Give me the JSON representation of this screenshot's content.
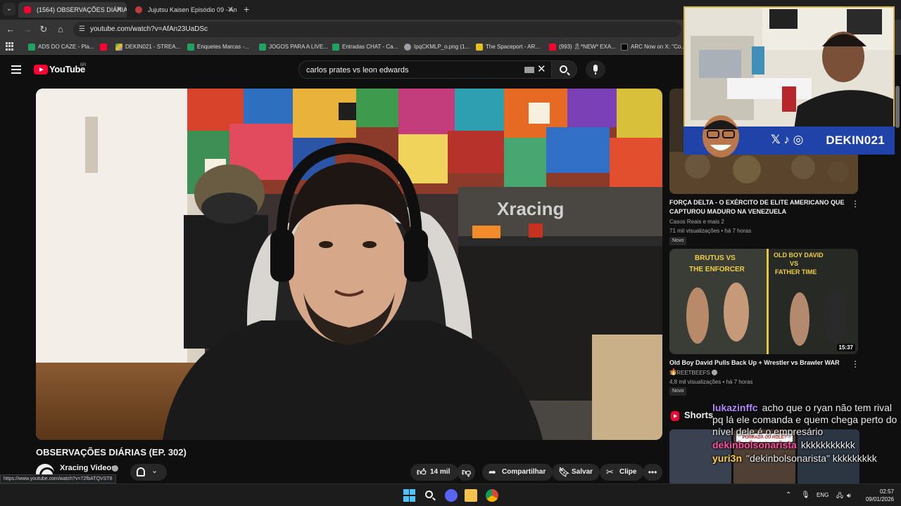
{
  "browser": {
    "tabs": [
      {
        "label": "(1564) OBSERVAÇÕES DIÁRIAS",
        "active": true
      },
      {
        "label": "Jujutsu Kaisen Episódio 09 - An",
        "active": false
      }
    ],
    "url": "youtube.com/watch?v=AfAn23UaDSc",
    "bookmarks": [
      {
        "label": "ADS DO CAZE - Pla...",
        "icon": "sheets-icon"
      },
      {
        "label": "",
        "icon": "youtube-icon"
      },
      {
        "label": "DEKIN021 - STREA...",
        "icon": "drive-icon"
      },
      {
        "label": "Enquetes Marcas -...",
        "icon": "sheets-icon"
      },
      {
        "label": "JOGOS PARA A LIVE...",
        "icon": "sheets-icon"
      },
      {
        "label": "Entradas CHAT - Ca...",
        "icon": "sheets-icon"
      },
      {
        "label": "IpqCKMLP_o.png (1...",
        "icon": "globe-icon"
      },
      {
        "label": "The Spaceport - AR...",
        "icon": "spaceport-icon"
      },
      {
        "label": "(993) 🎗*NEW* EXA...",
        "icon": "youtube-icon"
      },
      {
        "label": "ARC Now on X: \"Co...",
        "icon": "x-icon"
      }
    ],
    "status_url": "https://www.youtube.com/watch?v=72fbATQVST8"
  },
  "youtube": {
    "logo_text": "YouTube",
    "country_code": "BR",
    "search_query": "carlos prates vs leon edwards"
  },
  "video": {
    "title": "OBSERVAÇÕES DIÁRIAS (EP. 302)",
    "channel": "Xracing Videos",
    "likes": "14 mil",
    "share_label": "Compartilhar",
    "save_label": "Salvar",
    "clip_label": "Clipe",
    "wall_logo_text": "Xracing"
  },
  "sidebar": {
    "rec1": {
      "title": "FORÇA DELTA - O EXÉRCITO DE ELITE AMERICANO QUE CAPTUROU MADURO NA VENEZUELA",
      "channel": "Casos Reais e mais 2",
      "meta": "71 mil visualizações • há 7 horas",
      "badge": "Novo"
    },
    "rec2": {
      "title": "Old Boy David Pulls Back Up + Wrestler vs Brawler WAR 🔥",
      "channel": "STREETBEEFS",
      "meta": "4,8 mil visualizações • há 7 horas",
      "badge": "Novo",
      "duration": "15:37",
      "thumb_left_text": "BRUTUS VS THE ENFORCER",
      "thumb_right_text": "OLD BOY DAVID VS FATHER TIME"
    },
    "shorts_label": "Shorts",
    "short_caption": "PORRADA OU ROLÊ?"
  },
  "stream": {
    "handle": "DEKIN021",
    "chat": [
      {
        "user": "lukazinffc",
        "color": "#b488ff",
        "text": "acho que o ryan não tem rival pq lá ele comanda e quem chega perto do nível dele é o empresário"
      },
      {
        "user": "dekinbolsonarista",
        "color": "#ff4fa3",
        "text": "kkkkkkkkkkk"
      },
      {
        "user": "yuri3n",
        "color": "#ffd23f",
        "text": "\"dekinbolsonarista\" kkkkkkkkk"
      }
    ]
  },
  "taskbar": {
    "language": "ENG",
    "time": "02:57",
    "date": "09/01/2026"
  }
}
